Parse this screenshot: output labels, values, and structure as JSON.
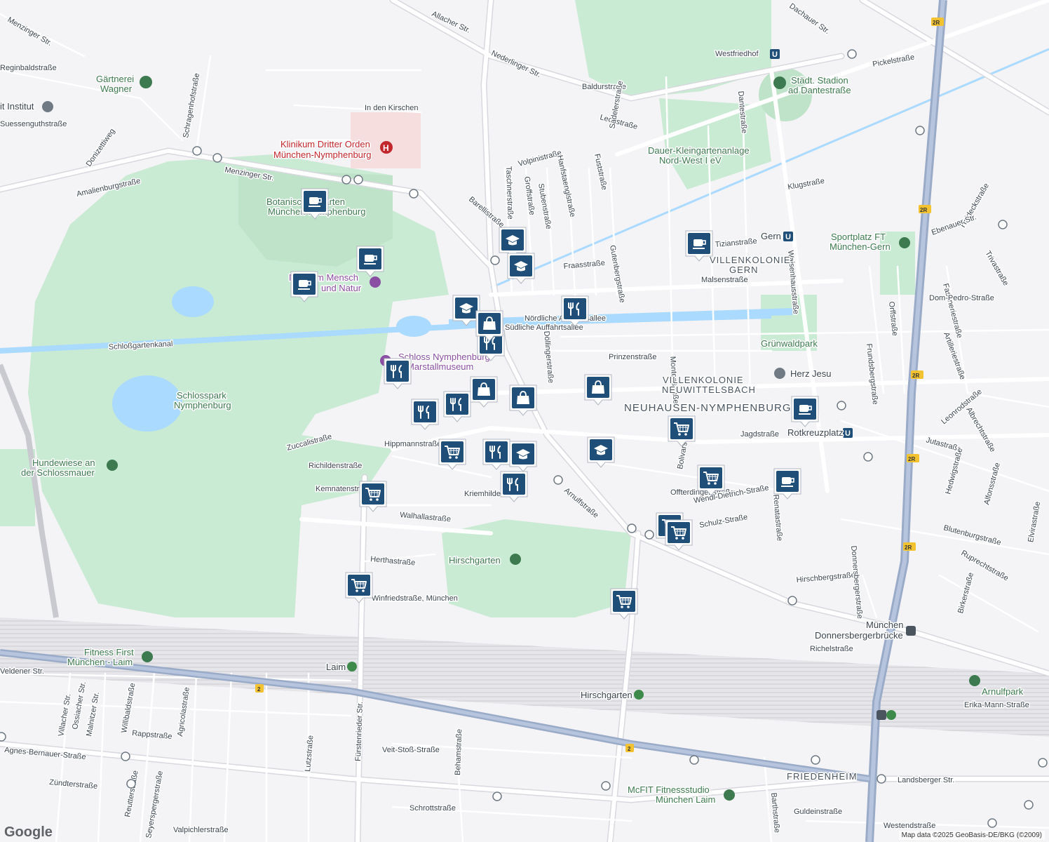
{
  "map": {
    "streets": [
      "Menzinger Str.",
      "Allacher Str.",
      "Nederlinger Str.",
      "Baldurstraße",
      "Dachauer Str.",
      "Pickelstraße",
      "Westfriedhof",
      "Lechstraße",
      "Volpinistraße",
      "Barellistraße",
      "Taschnerstraße",
      "Groffstraße",
      "Stubenstraße",
      "Hanfstaenglstraße",
      "Fuststraße",
      "Sadelerstraße",
      "Dantestraße",
      "Klugstraße",
      "Tizianstraße",
      "Fraasstraße",
      "Gutenbergstraße",
      "Malsenstraße",
      "Nördliche Auffahrtsallee",
      "Südliche Auffahrtsallee",
      "Döllingerstraße",
      "Prinzenstraße",
      "Montenstraße",
      "Waisenhausstraße",
      "Orffstraße",
      "Frundsbergstraße",
      "Fasaneriestraße",
      "Artilleriestraße",
      "Leonrodstraße",
      "Albrechtstraße",
      "Jutastraße",
      "Hedwigstraße",
      "Alfonsstraße",
      "Heideckstraße",
      "Trivastraße",
      "Ebenauer Str.",
      "Dom-Pedro-Straße",
      "Jagdstraße",
      "Bolivarstraße",
      "Offterdingenstraße",
      "Wendl-Dietrich-Straße",
      "Renatastraße",
      "Arnulfstraße",
      "Schulz-Straße",
      "Blutenburgstraße",
      "Ruprechtstraße",
      "Elvirastraße",
      "Birkerstraße",
      "Hirschbergstraße",
      "Donnersbergerstraße",
      "Richelstraße",
      "Erika-Mann-Straße",
      "Kriemhildenstraße",
      "Walhallastraße",
      "Herthastraße",
      "Kemnatenstraße",
      "Richildenstraße",
      "Zuccalistraße",
      "Hippmannstraße",
      "Winfriedstraße, München",
      "Veldener Str.",
      "Villacher Str.",
      "Ossiacher Str.",
      "Malnitzer Str.",
      "Willibaldstraße",
      "Agricolastraße",
      "Rappstraße",
      "Agnes-Bernauer-Straße",
      "Zündterstraße",
      "Reutterstraße",
      "Seyerspergerstraße",
      "Valpichlerstraße",
      "Lutzstraße",
      "Fürstenrieder Str.",
      "Behamstraße",
      "Veit-Stoß-Straße",
      "Schrottstraße",
      "Barthstraße",
      "Guldeinstraße",
      "Westendstraße",
      "Landsberger Str.",
      "Schragenhofstraße",
      "Amalienburgstraße",
      "Donizettiweg",
      "Suessenguthstraße",
      "Menzinger Str.",
      "Reginbaldstraße",
      "In den Kirschen",
      "Schloßgartenkanal"
    ],
    "areas": [
      "VILLENKOLONIE",
      "GERN",
      "VILLENKOLONIE",
      "NEUWITTELSBACH",
      "NEUHAUSEN-NYMPHENBURG",
      "FRIEDENHEIM"
    ],
    "pois": [
      {
        "name": "Gärtnerei",
        "name2": "Wagner",
        "color": "#3d7a4f"
      },
      {
        "name": "Klinikum Dritter Orden",
        "name2": "München-Nymphenburg",
        "color": "#c2272d"
      },
      {
        "name": "Botanischer Garten",
        "name2": "München-Nymphenburg",
        "color": "#3d7a4f"
      },
      {
        "name": "Museum Mensch",
        "name2": "und Natur",
        "color": "#8a4fa3"
      },
      {
        "name": "Schloss Nymphenburg",
        "name2": "Marstallmuseum",
        "color": "#8a4fa3"
      },
      {
        "name": "Schlosspark",
        "name2": "Nymphenburg",
        "color": "#3d7a4f"
      },
      {
        "name": "Hundewiese an",
        "name2": "der Schlossmauer",
        "color": "#3d7a4f"
      },
      {
        "name": "Hirschgarten",
        "name2": "",
        "color": "#3d7a4f"
      },
      {
        "name": "Städt. Stadion",
        "name2": "ad Dantestraße",
        "color": "#3d7a4f"
      },
      {
        "name": "Dauer-Kleingartenanlage",
        "name2": "Nord-West I eV",
        "color": "#3d7a4f"
      },
      {
        "name": "Sportplatz FT",
        "name2": "München-Gern",
        "color": "#3d7a4f"
      },
      {
        "name": "Grünwaldpark",
        "name2": "",
        "color": "#3d7a4f"
      },
      {
        "name": "Herz Jesu",
        "name2": "",
        "color": "#4a5560"
      },
      {
        "name": "Fitness First",
        "name2": "München - Laim",
        "color": "#3d7a4f"
      },
      {
        "name": "McFIT Fitnessstudio",
        "name2": "München Laim",
        "color": "#3d7a4f"
      },
      {
        "name": "Arnulfpark",
        "name2": "",
        "color": "#3d7a4f"
      },
      {
        "name": "it Institut",
        "name2": "",
        "color": "#4a5560"
      }
    ],
    "stations": [
      "Westfriedhof",
      "Gern",
      "Rotkreuzplatz",
      "Laim",
      "Hirschgarten",
      "München",
      "Donnersbergerbrücke"
    ],
    "highway_shields": [
      "2R",
      "2R",
      "2R",
      "2R",
      "2R",
      "2",
      "2"
    ]
  },
  "colors": {
    "marker": "#1f4e79",
    "park": "#c9ead3",
    "water": "#aadaff",
    "rail": "#7f8fa8",
    "highway": "#9aabc8",
    "background": "#f4f3f6"
  },
  "markers": [
    {
      "icon": "coffee-icon"
    },
    {
      "icon": "coffee-icon"
    },
    {
      "icon": "coffee-icon"
    },
    {
      "icon": "coffee-icon"
    },
    {
      "icon": "coffee-icon"
    },
    {
      "icon": "coffee-icon"
    },
    {
      "icon": "education-icon"
    },
    {
      "icon": "education-icon"
    },
    {
      "icon": "education-icon"
    },
    {
      "icon": "education-icon"
    },
    {
      "icon": "education-icon"
    },
    {
      "icon": "restaurant-icon"
    },
    {
      "icon": "restaurant-icon"
    },
    {
      "icon": "restaurant-icon"
    },
    {
      "icon": "restaurant-icon"
    },
    {
      "icon": "restaurant-icon"
    },
    {
      "icon": "restaurant-icon"
    },
    {
      "icon": "restaurant-icon"
    },
    {
      "icon": "shopping-bag-icon"
    },
    {
      "icon": "shopping-bag-icon"
    },
    {
      "icon": "shopping-bag-icon"
    },
    {
      "icon": "shopping-bag-icon"
    },
    {
      "icon": "shopping-cart-icon"
    },
    {
      "icon": "shopping-cart-icon"
    },
    {
      "icon": "shopping-cart-icon"
    },
    {
      "icon": "shopping-cart-icon"
    },
    {
      "icon": "shopping-cart-icon"
    },
    {
      "icon": "shopping-cart-icon"
    },
    {
      "icon": "shopping-cart-icon"
    },
    {
      "icon": "shopping-cart-icon"
    }
  ],
  "attribution": "Map data ©2025 GeoBasis-DE/BKG (©2009)",
  "logo": "Google"
}
